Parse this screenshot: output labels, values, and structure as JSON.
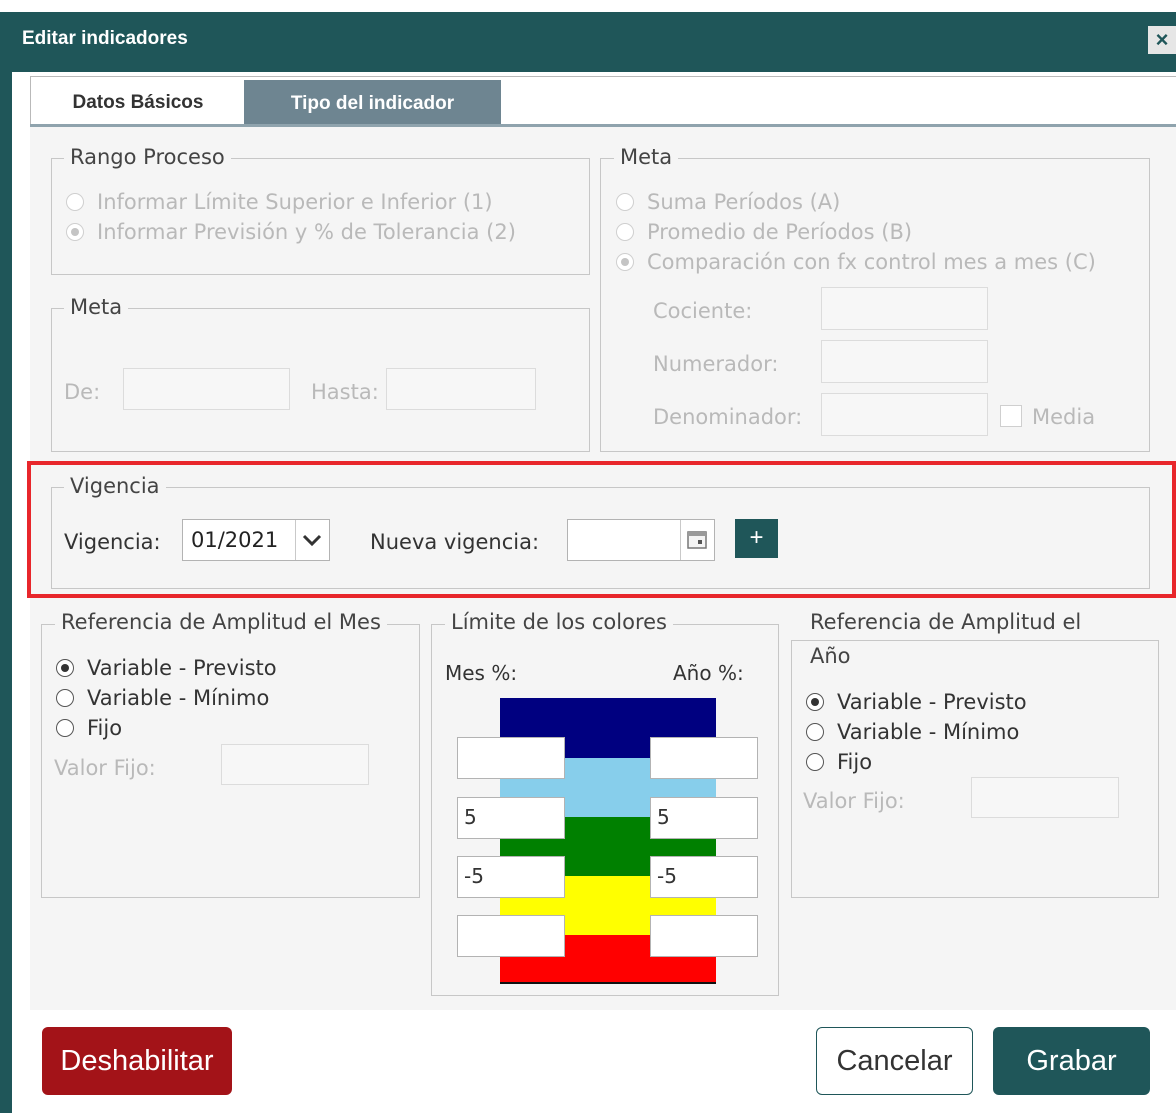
{
  "dialog": {
    "title": "Editar indicadores",
    "close_icon": "×"
  },
  "tabs": [
    {
      "label": "Datos Básicos",
      "active": false
    },
    {
      "label": "Tipo del indicador",
      "active": true
    }
  ],
  "rango_proceso": {
    "legend": "Rango Proceso",
    "options": [
      {
        "label": "Informar Límite Superior e Inferior (1)",
        "checked": false
      },
      {
        "label": "Informar Previsión y % de Tolerancia (2)",
        "checked": true
      }
    ]
  },
  "meta_left": {
    "legend": "Meta",
    "from_label": "De:",
    "to_label": "Hasta:",
    "from_value": "",
    "to_value": ""
  },
  "meta_right": {
    "legend": "Meta",
    "options": [
      {
        "label": "Suma Períodos (A)",
        "checked": false
      },
      {
        "label": "Promedio de Períodos (B)",
        "checked": false
      },
      {
        "label": "Comparación con fx control mes a mes (C)",
        "checked": true
      }
    ],
    "cociente_label": "Cociente:",
    "numerador_label": "Numerador:",
    "denominador_label": "Denominador:",
    "media_label": "Media",
    "media_checked": false
  },
  "vigencia": {
    "legend": "Vigencia",
    "vigencia_label": "Vigencia:",
    "vigencia_value": "01/2021",
    "nueva_label": "Nueva vigencia:",
    "nueva_value": "",
    "add_label": "+"
  },
  "ref_mes": {
    "legend": "Referencia de Amplitud el Mes",
    "options": [
      {
        "label": "Variable - Previsto",
        "checked": true
      },
      {
        "label": "Variable - Mínimo",
        "checked": false
      },
      {
        "label": "Fijo",
        "checked": false
      }
    ],
    "valor_fijo_label": "Valor Fijo:"
  },
  "limite_colores": {
    "legend": "Límite de los colores",
    "mes_label": "Mes %:",
    "ano_label": "Año %:",
    "bands": [
      "#000080",
      "#87ceeb",
      "#008000",
      "#ffff00",
      "#ff0000"
    ],
    "mes_values": [
      "",
      "5",
      "-5",
      ""
    ],
    "ano_values": [
      "",
      "5",
      "-5",
      ""
    ]
  },
  "ref_ano": {
    "legend_line1": "Referencia de Amplitud el",
    "legend_line2": "Año",
    "options": [
      {
        "label": "Variable - Previsto",
        "checked": true
      },
      {
        "label": "Variable - Mínimo",
        "checked": false
      },
      {
        "label": "Fijo",
        "checked": false
      }
    ],
    "valor_fijo_label": "Valor Fijo:"
  },
  "footer": {
    "disable_label": "Deshabilitar",
    "cancel_label": "Cancelar",
    "save_label": "Grabar"
  },
  "colors": {
    "header": "#1f5659",
    "tab_active": "#6e8591",
    "danger": "#a31318",
    "highlight": "#e8262b"
  }
}
